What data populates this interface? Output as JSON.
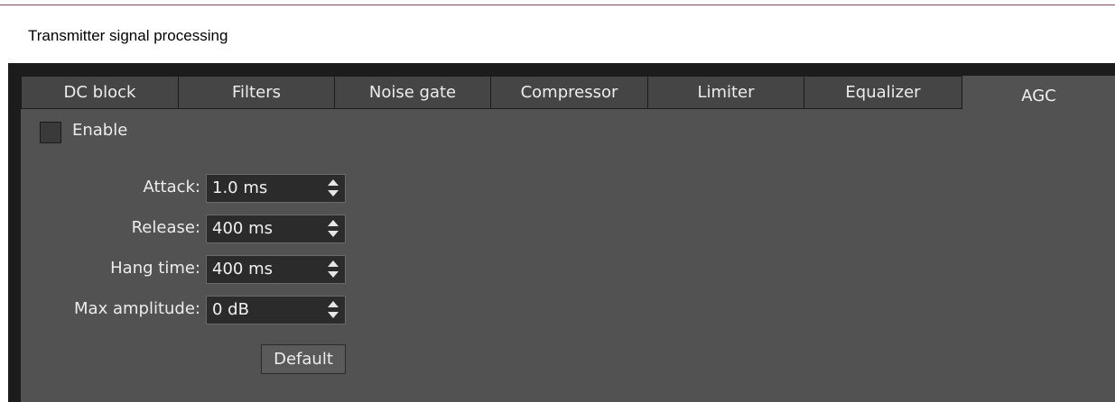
{
  "section": {
    "title": "Transmitter signal processing"
  },
  "tabs": [
    {
      "label": "DC block"
    },
    {
      "label": "Filters"
    },
    {
      "label": "Noise gate"
    },
    {
      "label": "Compressor"
    },
    {
      "label": "Limiter"
    },
    {
      "label": "Equalizer"
    },
    {
      "label": "AGC",
      "active": true
    }
  ],
  "agc": {
    "enable_label": "Enable",
    "enable_checked": false,
    "attack_label": "Attack:",
    "attack_value": "1.0 ms",
    "release_label": "Release:",
    "release_value": "400 ms",
    "hang_label": "Hang time:",
    "hang_value": "400 ms",
    "max_label": "Max amplitude:",
    "max_value": "0 dB",
    "default_label": "Default"
  },
  "colors": {
    "panel_bg": "#525252",
    "tab_bg": "#454545",
    "frame_bg": "#1c1c1c",
    "accent_rule": "#c0394a"
  }
}
